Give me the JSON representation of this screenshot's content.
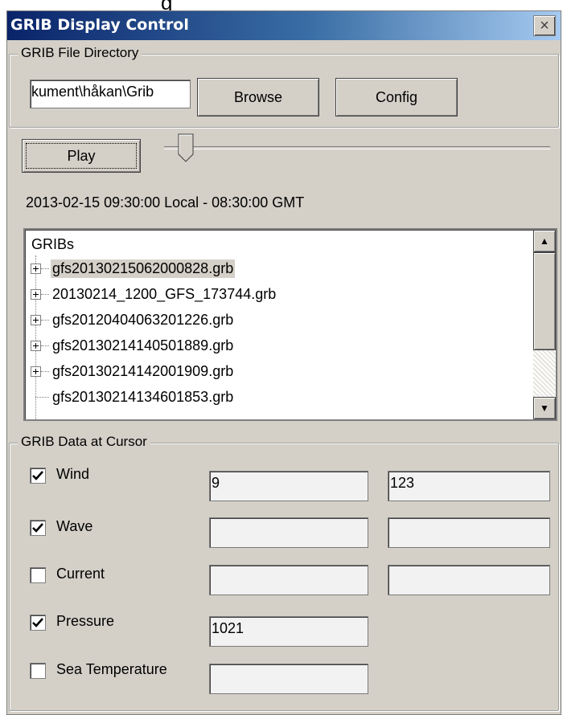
{
  "top_clip_text": "g",
  "window": {
    "title": "GRIB Display Control",
    "close_glyph": "×"
  },
  "file_directory": {
    "legend": "GRIB File Directory",
    "path_value": "kument\\håkan\\Grib",
    "browse_label": "Browse",
    "config_label": "Config"
  },
  "playback": {
    "play_label": "Play",
    "slider_position": 0.04,
    "timestamp": "2013-02-15 09:30:00 Local - 08:30:00 GMT"
  },
  "gribs": {
    "root_label": "GRIBs",
    "items": [
      {
        "label": "gfs20130215062000828.grb",
        "expandable": true,
        "selected": true
      },
      {
        "label": "20130214_1200_GFS_173744.grb",
        "expandable": true,
        "selected": false
      },
      {
        "label": "gfs20120404063201226.grb",
        "expandable": true,
        "selected": false
      },
      {
        "label": "gfs20130214140501889.grb",
        "expandable": true,
        "selected": false
      },
      {
        "label": "gfs20130214142001909.grb",
        "expandable": true,
        "selected": false
      },
      {
        "label": "gfs20130214134601853.grb",
        "expandable": false,
        "selected": false
      }
    ]
  },
  "cursor_data": {
    "legend": "GRIB Data at Cursor",
    "rows": [
      {
        "label": "Wind",
        "checked": true,
        "value1": "9",
        "value2": "123"
      },
      {
        "label": "Wave",
        "checked": true,
        "value1": "",
        "value2": ""
      },
      {
        "label": "Current",
        "checked": false,
        "value1": "",
        "value2": ""
      },
      {
        "label": "Pressure",
        "checked": true,
        "value1": "1021"
      },
      {
        "label": "Sea Temperature",
        "checked": false,
        "value1": ""
      }
    ]
  },
  "icons": {
    "close": "close-icon",
    "expand": "plus-box-icon",
    "scroll_up": "arrow-up-icon",
    "scroll_down": "arrow-down-icon",
    "check": "checkmark-icon"
  },
  "colors": {
    "title_gradient_start": "#0a246a",
    "title_gradient_end": "#a6caf0",
    "face": "#d4d0c8"
  }
}
